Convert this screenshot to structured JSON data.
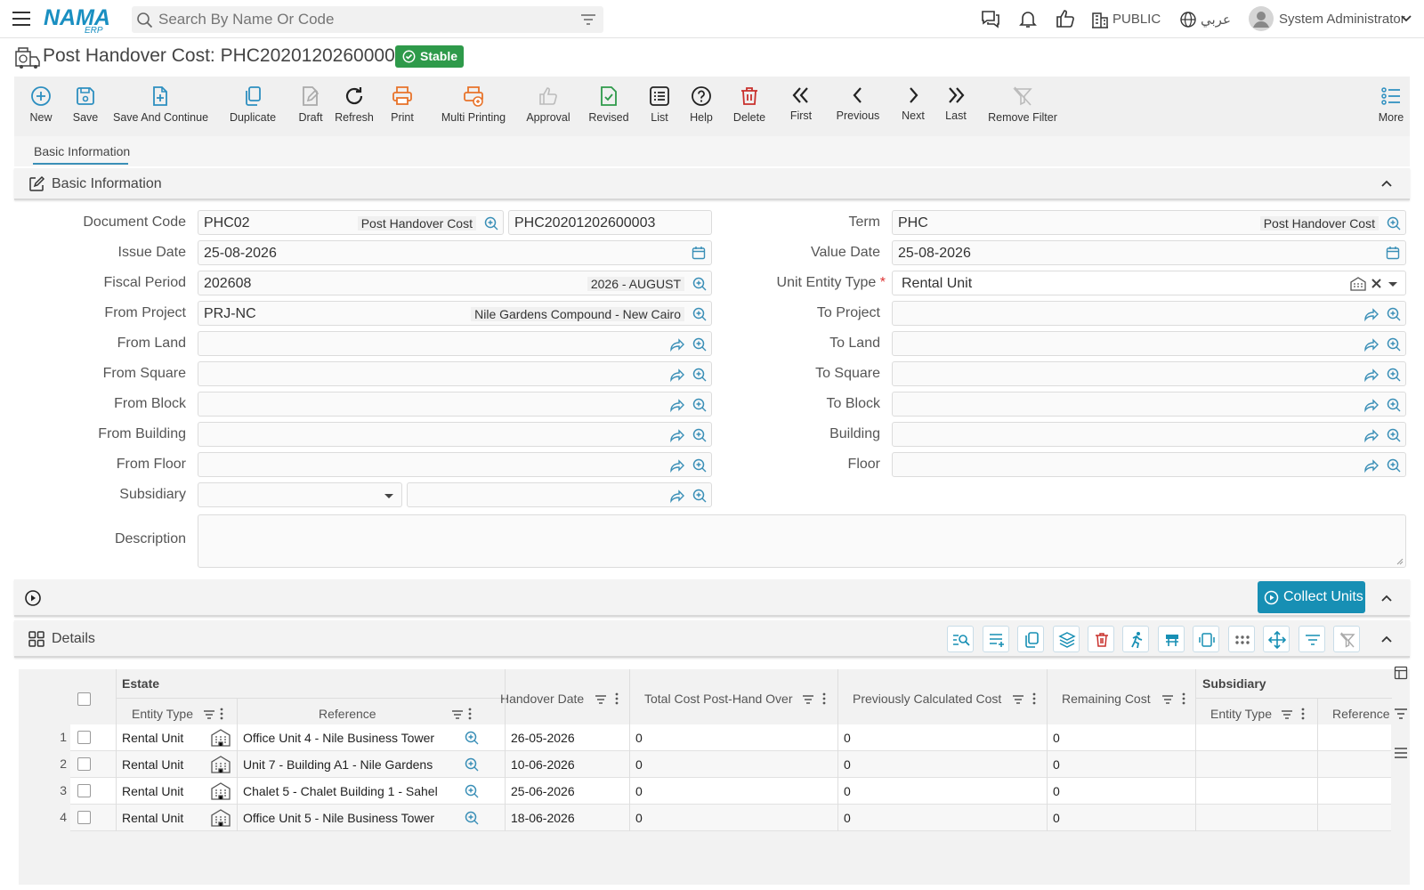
{
  "header": {
    "search_placeholder": "Search By Name Or Code",
    "branch": "PUBLIC",
    "language": "عربي",
    "user": "System Administrator",
    "logo": "NAMA",
    "logo_sub": "ERP"
  },
  "page": {
    "title": "Post Handover Cost: PHC20201202600003",
    "status": "Stable"
  },
  "toolbar": [
    "New",
    "Save",
    "Save And Continue",
    "Duplicate",
    "Draft",
    "Refresh",
    "Print",
    "Multi Printing",
    "Approval",
    "Revised",
    "List",
    "Help",
    "Delete",
    "First",
    "Previous",
    "Next",
    "Last",
    "Remove Filter",
    "More"
  ],
  "tabs": {
    "basic": "Basic Information"
  },
  "section_basic": "Basic Information",
  "labels": {
    "document_code": "Document Code",
    "issue_date": "Issue Date",
    "fiscal_period": "Fiscal Period",
    "from_project": "From Project",
    "from_land": "From Land",
    "from_square": "From Square",
    "from_block": "From Block",
    "from_building": "From Building",
    "from_floor": "From Floor",
    "subsidiary": "Subsidiary",
    "description": "Description",
    "term": "Term",
    "value_date": "Value Date",
    "unit_entity_type": "Unit Entity Type",
    "to_project": "To Project",
    "to_land": "To Land",
    "to_square": "To Square",
    "to_block": "To Block",
    "building": "Building",
    "floor": "Floor"
  },
  "values": {
    "document_code": "PHC02",
    "document_code_desc": "Post Handover Cost",
    "document_number": "PHC20201202600003",
    "issue_date": "25-08-2026",
    "fiscal_period": "202608",
    "fiscal_period_desc": "2026 - AUGUST",
    "from_project": "PRJ-NC",
    "from_project_desc": "Nile Gardens Compound - New Cairo",
    "term": "PHC",
    "term_desc": "Post Handover Cost",
    "value_date": "25-08-2026",
    "unit_entity_type": "Rental Unit"
  },
  "required_mark": "*",
  "collect_units": "Collect Units",
  "section_details": "Details",
  "grid": {
    "group_estate": "Estate",
    "group_subsidiary": "Subsidiary",
    "cols": {
      "entity_type": "Entity Type",
      "reference": "Reference",
      "handover_date": "Handover Date",
      "total_cost": "Total Cost Post-Hand Over",
      "prev_cost": "Previously Calculated Cost",
      "remaining_cost": "Remaining Cost",
      "sub_entity_type": "Entity Type",
      "sub_reference": "Reference"
    },
    "rows": [
      {
        "n": "1",
        "entity_type": "Rental Unit",
        "reference": "Office Unit 4 - Nile Business Tower",
        "handover_date": "26-05-2026",
        "total_cost": "0",
        "prev_cost": "0",
        "remaining_cost": "0"
      },
      {
        "n": "2",
        "entity_type": "Rental Unit",
        "reference": "Unit 7 - Building A1 - Nile Gardens",
        "handover_date": "10-06-2026",
        "total_cost": "0",
        "prev_cost": "0",
        "remaining_cost": "0"
      },
      {
        "n": "3",
        "entity_type": "Rental Unit",
        "reference": "Chalet 5 - Chalet Building 1 - Sahel",
        "handover_date": "25-06-2026",
        "total_cost": "0",
        "prev_cost": "0",
        "remaining_cost": "0"
      },
      {
        "n": "4",
        "entity_type": "Rental Unit",
        "reference": "Office Unit 5 - Nile Business Tower",
        "handover_date": "18-06-2026",
        "total_cost": "0",
        "prev_cost": "0",
        "remaining_cost": "0"
      }
    ]
  },
  "colors": {
    "accent": "#178fb4",
    "stable": "#2e9a4a",
    "print": "#e8732a",
    "delete": "#c9302c",
    "save_dup": "#2d8fc0",
    "revised": "#2e9a4a"
  }
}
